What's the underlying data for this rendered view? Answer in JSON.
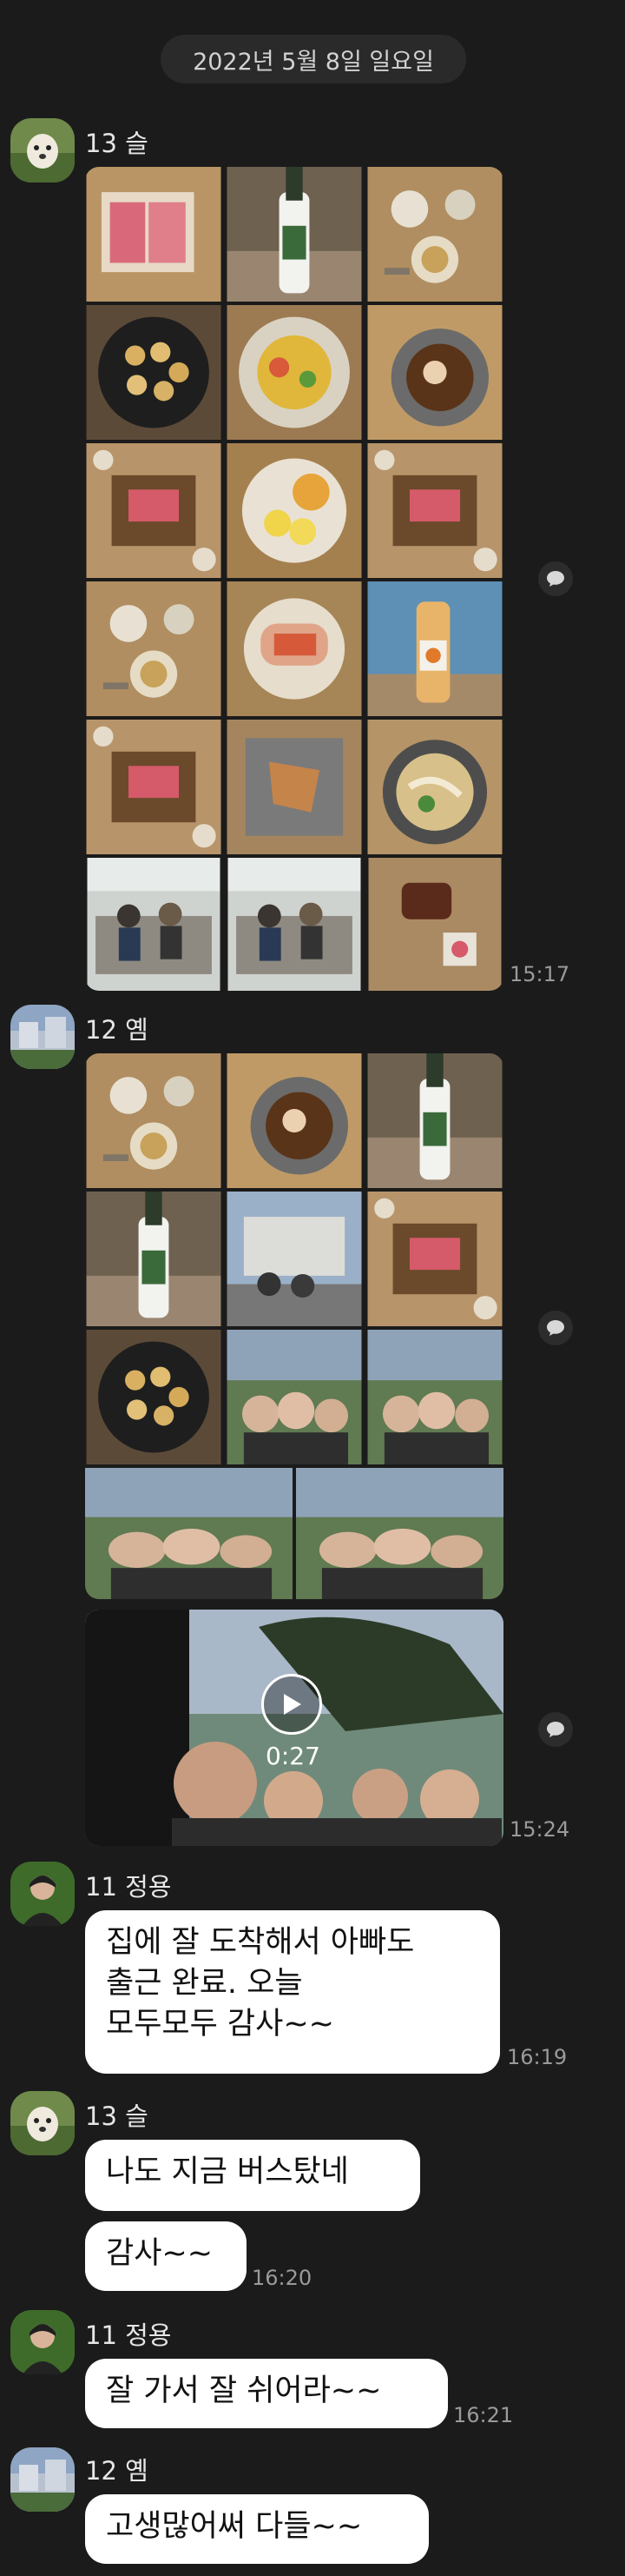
{
  "date_divider": "2022년 5월 8일 일요일",
  "messages": [
    {
      "sender": "13 슬",
      "avatar": "avatar-dog-icon",
      "time": "15:17",
      "photos": 18
    },
    {
      "sender": "12 옘",
      "avatar": "avatar-building-icon",
      "time": "15:24",
      "photos": 11,
      "video": {
        "duration": "0:27"
      }
    },
    {
      "sender": "11 정용",
      "avatar": "avatar-person-icon",
      "time": "16:19",
      "lines": [
        "집에 잘 도착해서 아빠도",
        "출근 완료. 오늘",
        "모두모두 감사~~"
      ]
    },
    {
      "sender": "13 슬",
      "avatar": "avatar-dog-icon",
      "time": "16:20",
      "lines": [
        "나도 지금 버스탔네"
      ],
      "followup": "감사~~"
    },
    {
      "sender": "11 정용",
      "avatar": "avatar-person-icon",
      "time": "16:21",
      "lines": [
        "잘 가서 잘 쉬어라~~"
      ]
    },
    {
      "sender": "12 옘",
      "avatar": "avatar-building-icon",
      "lines": [
        "고생많어써 다들~~"
      ]
    }
  ],
  "colors": {
    "background": "#1b1b1b",
    "bubble": "#ffffff",
    "time": "#9a9a9a",
    "chip": "#2a2a2a"
  }
}
